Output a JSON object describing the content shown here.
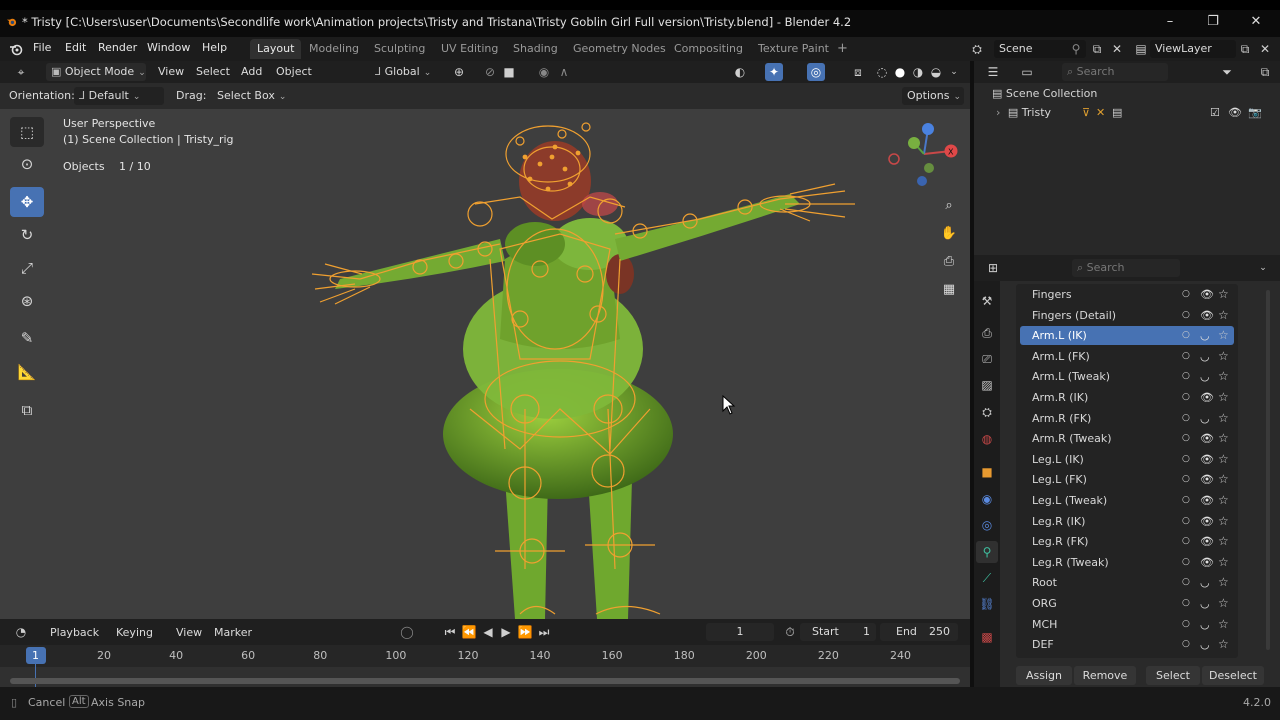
{
  "window": {
    "title": "* Tristy [C:\\Users\\user\\Documents\\Secondlife work\\Animation projects\\Tristy and Tristana\\Tristy Goblin Girl Full version\\Tristy.blend] - Blender 4.2",
    "controls": {
      "minimize": "–",
      "maximize": "❐",
      "close": "✕"
    }
  },
  "menu": {
    "items": [
      "File",
      "Edit",
      "Render",
      "Window",
      "Help"
    ],
    "workspaces": [
      "Layout",
      "Modeling",
      "Sculpting",
      "UV Editing",
      "Shading",
      "Geometry Nodes",
      "Compositing",
      "Texture Paint"
    ],
    "add_workspace": "+",
    "scene_label": "Scene",
    "viewlayer_label": "ViewLayer"
  },
  "viewport_header": {
    "mode": "Object Mode",
    "menus": [
      "View",
      "Select",
      "Add",
      "Object"
    ],
    "transform_orientation": "Global",
    "options_label": "Options",
    "orientation_label": "Orientation:",
    "orientation_value": "Default",
    "drag_label": "Drag:",
    "drag_value": "Select Box"
  },
  "viewport_overlay": {
    "perspective": "User Perspective",
    "collection": "(1) Scene Collection | Tristy_rig",
    "objects_label": "Objects",
    "objects_value": "1 / 10"
  },
  "tools": [
    "select-box",
    "cursor",
    "move",
    "rotate",
    "scale",
    "transform",
    "annotate",
    "measure",
    "add-cube"
  ],
  "active_tool": "move",
  "outliner": {
    "search_placeholder": "Search",
    "root": "Scene Collection",
    "items": [
      {
        "label": "Tristy"
      }
    ]
  },
  "properties": {
    "search_placeholder": "Search",
    "bone_collections": [
      {
        "name": "Fingers",
        "visible": true,
        "selected": false
      },
      {
        "name": "Fingers (Detail)",
        "visible": true,
        "selected": false
      },
      {
        "name": "Arm.L (IK)",
        "visible": false,
        "selected": true
      },
      {
        "name": "Arm.L (FK)",
        "visible": false,
        "selected": false
      },
      {
        "name": "Arm.L (Tweak)",
        "visible": false,
        "selected": false
      },
      {
        "name": "Arm.R (IK)",
        "visible": true,
        "selected": false
      },
      {
        "name": "Arm.R (FK)",
        "visible": false,
        "selected": false
      },
      {
        "name": "Arm.R (Tweak)",
        "visible": true,
        "selected": false
      },
      {
        "name": "Leg.L (IK)",
        "visible": true,
        "selected": false
      },
      {
        "name": "Leg.L (FK)",
        "visible": true,
        "selected": false
      },
      {
        "name": "Leg.L (Tweak)",
        "visible": true,
        "selected": false
      },
      {
        "name": "Leg.R (IK)",
        "visible": true,
        "selected": false
      },
      {
        "name": "Leg.R (FK)",
        "visible": true,
        "selected": false
      },
      {
        "name": "Leg.R (Tweak)",
        "visible": true,
        "selected": false
      },
      {
        "name": "Root",
        "visible": false,
        "selected": false
      },
      {
        "name": "ORG",
        "visible": false,
        "selected": false
      },
      {
        "name": "MCH",
        "visible": false,
        "selected": false
      },
      {
        "name": "DEF",
        "visible": false,
        "selected": false
      }
    ],
    "buttons": [
      "Assign",
      "Remove",
      "Select",
      "Deselect"
    ]
  },
  "timeline": {
    "menus": [
      "Playback",
      "Keying",
      "View",
      "Marker"
    ],
    "current_frame": "1",
    "start_label": "Start",
    "start_value": "1",
    "end_label": "End",
    "end_value": "250",
    "ruler_labels": [
      "1",
      "20",
      "40",
      "60",
      "80",
      "100",
      "120",
      "140",
      "160",
      "180",
      "200",
      "220",
      "240"
    ]
  },
  "statusbar": {
    "cancel": "Cancel",
    "alt_key": "Alt",
    "axis_snap": "Axis Snap",
    "version": "4.2.0"
  },
  "colors": {
    "accent": "#4772b3",
    "bone_orange": "#f0a030",
    "mesh_green": "#7fb83a",
    "viewport_bg": "#3e3e3e"
  }
}
